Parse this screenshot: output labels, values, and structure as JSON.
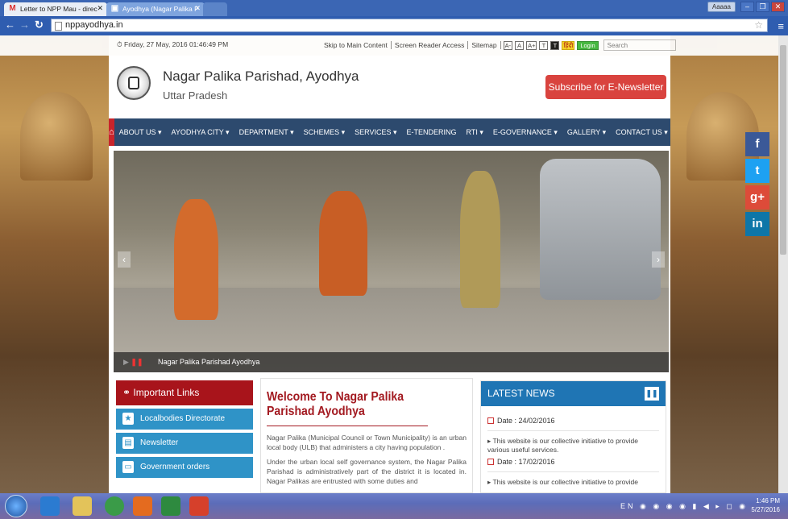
{
  "browser": {
    "tabs": [
      {
        "label": "Letter to NPP Mau - direc",
        "favicon": "M"
      },
      {
        "label": "Ayodhya (Nagar Palika P",
        "favicon": "▣"
      }
    ],
    "profile": "Aaaaa",
    "url": "nppayodhya.in"
  },
  "topbar": {
    "datetime": "Friday, 27 May, 2016 01:46:49 PM",
    "skip": "Skip to Main Content",
    "reader": "Screen Reader Access",
    "sitemap": "Sitemap",
    "font_small": "A-",
    "font_normal": "A",
    "font_large": "A+",
    "theme_light": "T",
    "theme_dark": "T",
    "hindi": "हिंदी",
    "login": "Login",
    "search_placeholder": "Search"
  },
  "header": {
    "title": "Nagar Palika Parishad, Ayodhya",
    "subtitle": "Uttar Pradesh",
    "subscribe": "Subscribe for E-Newsletter"
  },
  "nav": {
    "home_icon": "⌂",
    "items": [
      "ABOUT US ▾",
      "AYODHYA CITY ▾",
      "DEPARTMENT ▾",
      "SCHEMES ▾",
      "SERVICES ▾",
      "E-TENDERING",
      "RTI ▾",
      "E-GOVERNANCE ▾",
      "GALLERY ▾",
      "CONTACT US ▾"
    ]
  },
  "slider": {
    "caption": "Nagar Palika Parishad Ayodhya"
  },
  "links": {
    "heading": "Important Links",
    "items": [
      "Localbodies Directorate",
      "Newsletter",
      "Government orders"
    ]
  },
  "welcome": {
    "title": "Welcome To Nagar Palika Parishad Ayodhya",
    "p1": "Nagar Palika (Municipal Council or Town Municipality) is an urban local body (ULB) that administers a city having population .",
    "p2": "Under the urban local self governance system, the Nagar Palika Parishad is administratively part of the district it is located in. Nagar Palikas are entrusted with some duties and"
  },
  "news": {
    "heading": "LATEST NEWS",
    "items": [
      {
        "date": "Date : 24/02/2016",
        "text": "This website is our collective initiative to provide various useful services."
      },
      {
        "date": "Date : 17/02/2016",
        "text": "This website is our collective initiative to provide"
      }
    ]
  },
  "social": [
    "f",
    "t",
    "g+",
    "in"
  ],
  "taskbar": {
    "lang": "EN",
    "time": "1:46 PM",
    "date": "5/27/2016"
  },
  "colors": {
    "nav_bg": "#2d4a6e",
    "accent_red": "#d9433e",
    "links_blue": "#2f93c7",
    "news_blue": "#1f75b4"
  }
}
